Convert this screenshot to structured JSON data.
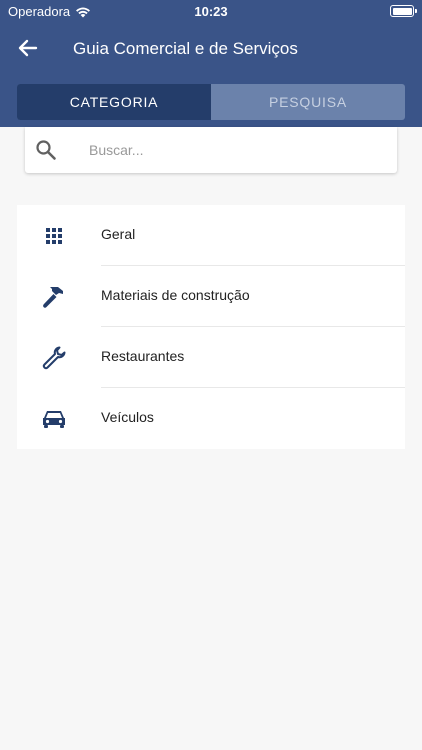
{
  "status_bar": {
    "carrier": "Operadora",
    "time": "10:23"
  },
  "header": {
    "title": "Guia Comercial e de Serviços",
    "back_icon": "arrow-left-icon"
  },
  "tabs": [
    {
      "label": "CATEGORIA",
      "active": true
    },
    {
      "label": "PESQUISA",
      "active": false
    }
  ],
  "search": {
    "placeholder": "Buscar...",
    "value": ""
  },
  "categories": [
    {
      "label": "Geral",
      "icon": "grid-icon"
    },
    {
      "label": "Materiais de construção",
      "icon": "hammer-icon"
    },
    {
      "label": "Restaurantes",
      "icon": "wrench-icon"
    },
    {
      "label": "Veículos",
      "icon": "car-icon"
    }
  ],
  "colors": {
    "header": "#3a5488",
    "tab_active": "#243d6a",
    "tab_inactive": "#6b82ab",
    "icon": "#243d6a"
  }
}
